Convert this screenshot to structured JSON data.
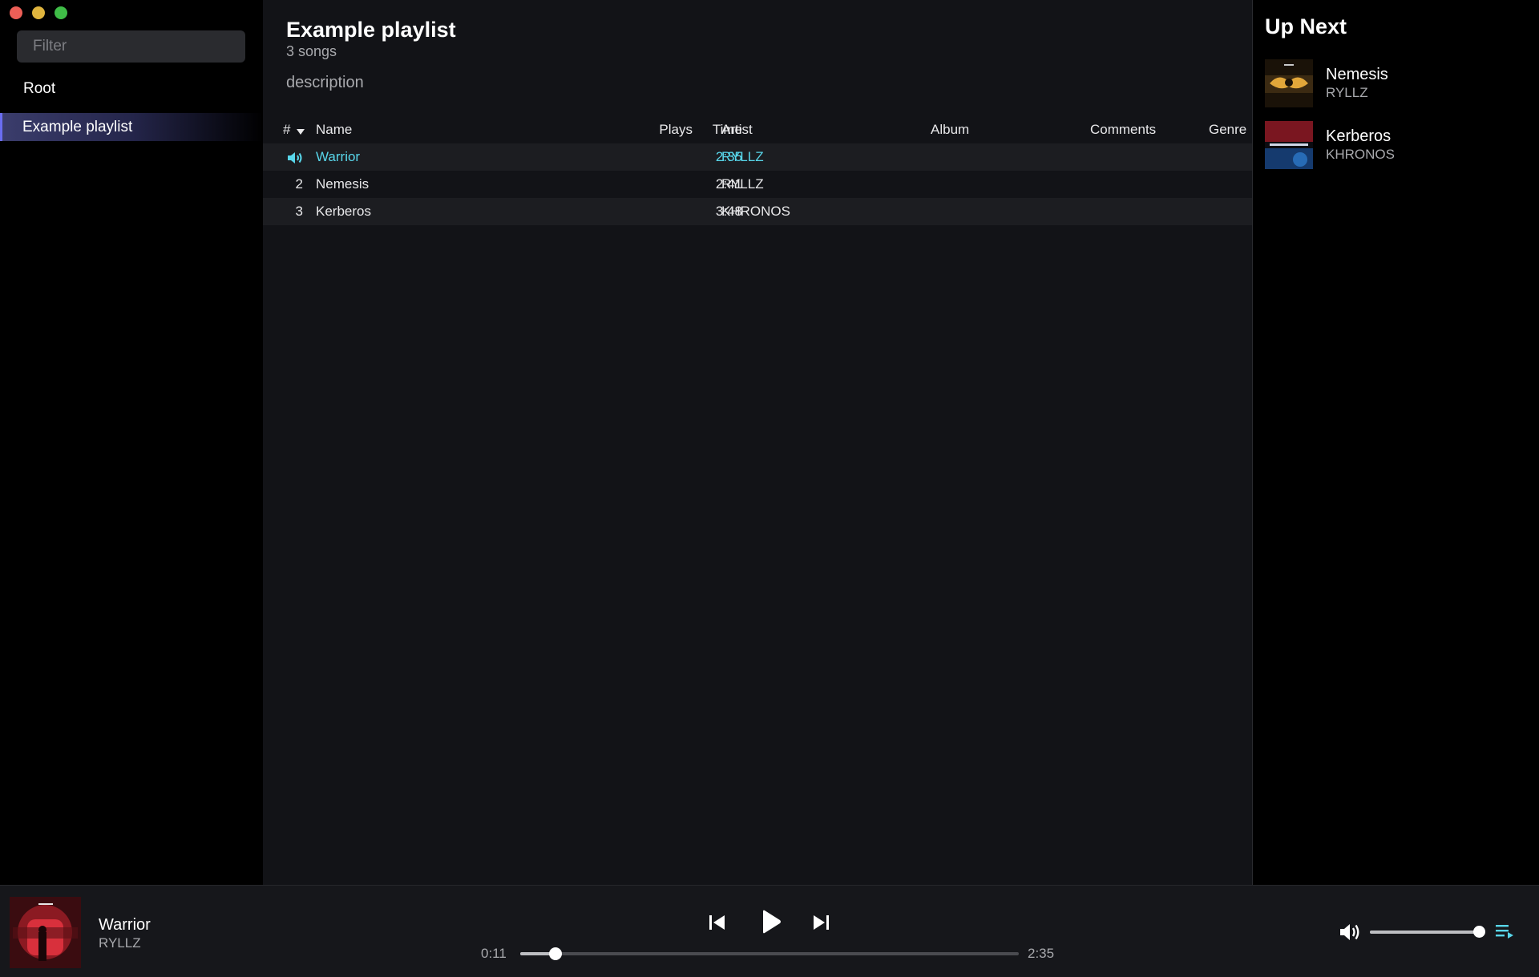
{
  "colors": {
    "accent": "#58d6ea",
    "selection": "#6a6df0",
    "background": "#121317"
  },
  "sidebar": {
    "filter_placeholder": "Filter",
    "root_label": "Root",
    "playlists": [
      {
        "label": "Example playlist",
        "selected": true
      }
    ]
  },
  "playlist": {
    "title": "Example playlist",
    "count": "3 songs",
    "description": "description",
    "columns": {
      "num": "#",
      "name": "Name",
      "plays": "Plays",
      "time": "Time",
      "artist": "Artist",
      "album": "Album",
      "comments": "Comments",
      "genre": "Genre"
    },
    "tracks": [
      {
        "num": "",
        "name": "Warrior",
        "plays": "",
        "time": "2:35",
        "artist": "RYLLZ",
        "album": "",
        "playing": true
      },
      {
        "num": "2",
        "name": "Nemesis",
        "plays": "",
        "time": "2:41",
        "artist": "RYLLZ",
        "album": ""
      },
      {
        "num": "3",
        "name": "Kerberos",
        "plays": "",
        "time": "3:48",
        "artist": "KHRONOS",
        "album": ""
      }
    ]
  },
  "up_next": {
    "title": "Up Next",
    "items": [
      {
        "name": "Nemesis",
        "artist": "RYLLZ"
      },
      {
        "name": "Kerberos",
        "artist": "KHRONOS"
      }
    ]
  },
  "now_playing": {
    "title": "Warrior",
    "artist": "RYLLZ",
    "current_time": "0:11",
    "total_time": "2:35",
    "progress": 0.071,
    "volume": 0.99
  }
}
